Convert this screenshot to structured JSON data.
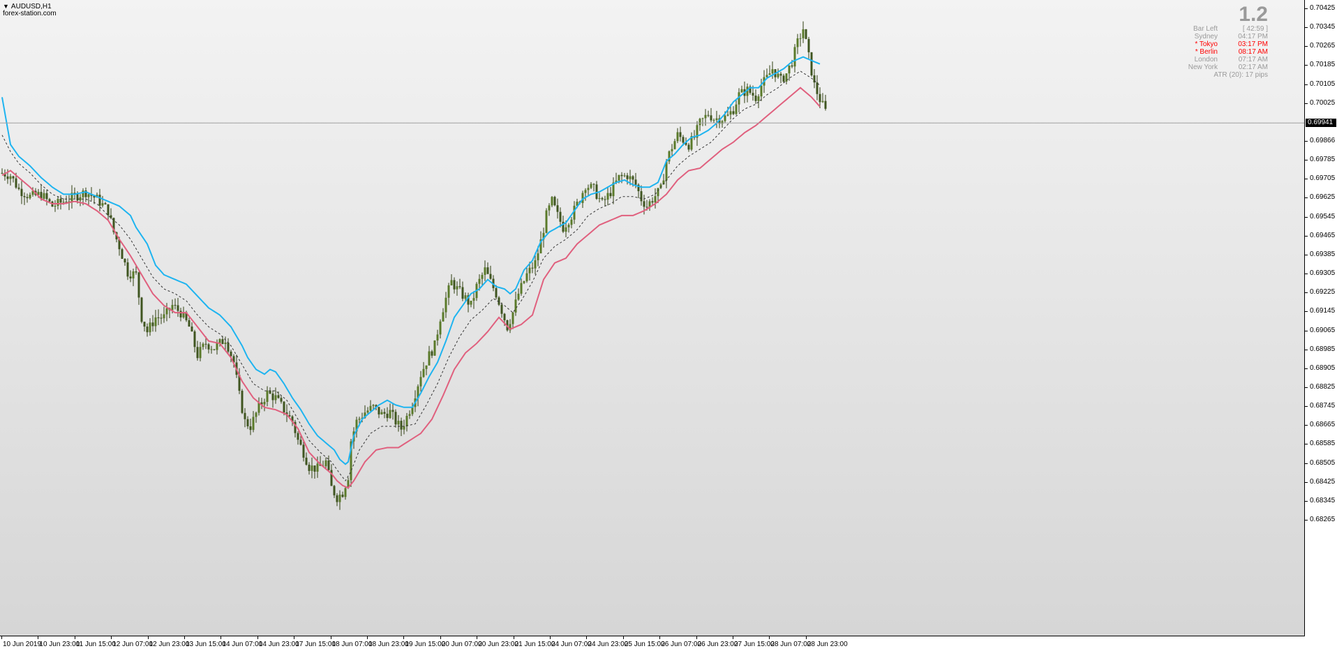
{
  "chart": {
    "symbol_timeframe": "AUDUSD,H1",
    "watermark": "forex-station.com",
    "current_price": "0.69941"
  },
  "session_panel": {
    "big_value": "1.2",
    "rows": [
      {
        "label": "Bar Left",
        "value": "[ 42:59 ]",
        "active": false
      },
      {
        "label": "Sydney",
        "value": "04:17 PM",
        "active": false
      },
      {
        "label": "* Tokyo",
        "value": "03:17 PM",
        "active": true
      },
      {
        "label": "* Berlin",
        "value": "08:17 AM",
        "active": true
      },
      {
        "label": "London",
        "value": "07:17 AM",
        "active": false
      },
      {
        "label": "New York",
        "value": "02:17 AM",
        "active": false
      }
    ],
    "atr": "ATR (20): 17 pips",
    "active_color": "#ff0000",
    "inactive_color": "#9a9a9a"
  },
  "price_axis": {
    "labels": [
      "0.70425",
      "0.70345",
      "0.70265",
      "0.70185",
      "0.70105",
      "0.70025",
      "0.69866",
      "0.69785",
      "0.69705",
      "0.69625",
      "0.69545",
      "0.69465",
      "0.69385",
      "0.69305",
      "0.69225",
      "0.69145",
      "0.69065",
      "0.68985",
      "0.68905",
      "0.68825",
      "0.68745",
      "0.68665",
      "0.68585",
      "0.68505",
      "0.68425",
      "0.68345",
      "0.68265"
    ]
  },
  "time_axis": {
    "labels": [
      "10 Jun 2019",
      "10 Jun 23:00",
      "11 Jun 15:00",
      "12 Jun 07:00",
      "12 Jun 23:00",
      "13 Jun 15:00",
      "14 Jun 07:00",
      "14 Jun 23:00",
      "17 Jun 15:00",
      "18 Jun 07:00",
      "18 Jun 23:00",
      "19 Jun 15:00",
      "20 Jun 07:00",
      "20 Jun 23:00",
      "21 Jun 15:00",
      "24 Jun 07:00",
      "24 Jun 23:00",
      "25 Jun 15:00",
      "26 Jun 07:00",
      "26 Jun 23:00",
      "27 Jun 15:00",
      "28 Jun 07:00",
      "28 Jun 23:00"
    ]
  },
  "colors": {
    "upper_band": "#1eb4f0",
    "lower_band": "#e0607e",
    "mid_line": "#333333",
    "candle_body": "#5a7a2a",
    "candle_wick": "#2e3e10"
  },
  "chart_data": {
    "type": "candlestick",
    "ylim": [
      0.68265,
      0.70465
    ],
    "grid": false,
    "price_anchors": [
      [
        0,
        0.6973
      ],
      [
        3,
        0.6972
      ],
      [
        6,
        0.6966
      ],
      [
        10,
        0.6963
      ],
      [
        14,
        0.6964
      ],
      [
        18,
        0.6959
      ],
      [
        22,
        0.6961
      ],
      [
        26,
        0.6963
      ],
      [
        30,
        0.6965
      ],
      [
        34,
        0.6962
      ],
      [
        38,
        0.6957
      ],
      [
        40,
        0.6948
      ],
      [
        42,
        0.6942
      ],
      [
        45,
        0.6931
      ],
      [
        48,
        0.693
      ],
      [
        50,
        0.6912
      ],
      [
        52,
        0.6906
      ],
      [
        55,
        0.6912
      ],
      [
        58,
        0.6912
      ],
      [
        61,
        0.6917
      ],
      [
        64,
        0.6914
      ],
      [
        67,
        0.6908
      ],
      [
        70,
        0.6896
      ],
      [
        73,
        0.6901
      ],
      [
        76,
        0.6899
      ],
      [
        80,
        0.6903
      ],
      [
        83,
        0.6893
      ],
      [
        85,
        0.6879
      ],
      [
        87,
        0.6868
      ],
      [
        89,
        0.6866
      ],
      [
        92,
        0.6874
      ],
      [
        95,
        0.688
      ],
      [
        98,
        0.6878
      ],
      [
        101,
        0.6873
      ],
      [
        104,
        0.6868
      ],
      [
        106,
        0.686
      ],
      [
        108,
        0.6855
      ],
      [
        110,
        0.6849
      ],
      [
        113,
        0.6848
      ],
      [
        116,
        0.6851
      ],
      [
        118,
        0.684
      ],
      [
        120,
        0.6836
      ],
      [
        122,
        0.6838
      ],
      [
        124,
        0.6845
      ],
      [
        125,
        0.686
      ],
      [
        127,
        0.6868
      ],
      [
        130,
        0.6872
      ],
      [
        133,
        0.6874
      ],
      [
        136,
        0.6871
      ],
      [
        139,
        0.6872
      ],
      [
        141,
        0.6868
      ],
      [
        143,
        0.6865
      ],
      [
        145,
        0.687
      ],
      [
        147,
        0.6876
      ],
      [
        150,
        0.6888
      ],
      [
        153,
        0.6896
      ],
      [
        155,
        0.69
      ],
      [
        157,
        0.6912
      ],
      [
        159,
        0.692
      ],
      [
        161,
        0.6927
      ],
      [
        163,
        0.6924
      ],
      [
        166,
        0.692
      ],
      [
        168,
        0.6917
      ],
      [
        170,
        0.6925
      ],
      [
        173,
        0.6932
      ],
      [
        175,
        0.6927
      ],
      [
        177,
        0.6922
      ],
      [
        179,
        0.6915
      ],
      [
        181,
        0.6908
      ],
      [
        183,
        0.6914
      ],
      [
        185,
        0.6922
      ],
      [
        188,
        0.693
      ],
      [
        191,
        0.6935
      ],
      [
        193,
        0.6944
      ],
      [
        195,
        0.6955
      ],
      [
        197,
        0.6961
      ],
      [
        199,
        0.6955
      ],
      [
        201,
        0.695
      ],
      [
        204,
        0.6955
      ],
      [
        207,
        0.6962
      ],
      [
        209,
        0.6968
      ],
      [
        212,
        0.6966
      ],
      [
        215,
        0.696
      ],
      [
        218,
        0.6965
      ],
      [
        221,
        0.6971
      ],
      [
        224,
        0.6972
      ],
      [
        227,
        0.6968
      ],
      [
        229,
        0.6962
      ],
      [
        231,
        0.6959
      ],
      [
        233,
        0.6962
      ],
      [
        236,
        0.6966
      ],
      [
        238,
        0.6978
      ],
      [
        240,
        0.6984
      ],
      [
        242,
        0.6989
      ],
      [
        244,
        0.6987
      ],
      [
        246,
        0.6985
      ],
      [
        248,
        0.6988
      ],
      [
        250,
        0.6994
      ],
      [
        253,
        0.6998
      ],
      [
        255,
        0.6996
      ],
      [
        258,
        0.6996
      ],
      [
        260,
        0.6997
      ],
      [
        262,
        0.7
      ],
      [
        264,
        0.7006
      ],
      [
        267,
        0.7008
      ],
      [
        270,
        0.7005
      ],
      [
        272,
        0.701
      ],
      [
        274,
        0.7013
      ],
      [
        276,
        0.7017
      ],
      [
        279,
        0.7012
      ],
      [
        281,
        0.7015
      ],
      [
        283,
        0.702
      ],
      [
        285,
        0.7028
      ],
      [
        287,
        0.7034
      ],
      [
        289,
        0.7022
      ],
      [
        291,
        0.701
      ],
      [
        293,
        0.7004
      ],
      [
        295,
        0.6999
      ]
    ],
    "upper_band_anchors": [
      [
        0,
        0.7005
      ],
      [
        3,
        0.6985
      ],
      [
        6,
        0.698
      ],
      [
        10,
        0.6976
      ],
      [
        14,
        0.6971
      ],
      [
        18,
        0.6967
      ],
      [
        22,
        0.6964
      ],
      [
        26,
        0.6964
      ],
      [
        30,
        0.6965
      ],
      [
        34,
        0.6963
      ],
      [
        38,
        0.6961
      ],
      [
        42,
        0.6959
      ],
      [
        46,
        0.6955
      ],
      [
        48,
        0.695
      ],
      [
        52,
        0.6943
      ],
      [
        55,
        0.6934
      ],
      [
        58,
        0.693
      ],
      [
        62,
        0.6928
      ],
      [
        66,
        0.6926
      ],
      [
        70,
        0.6921
      ],
      [
        74,
        0.6916
      ],
      [
        78,
        0.6913
      ],
      [
        82,
        0.6908
      ],
      [
        86,
        0.69
      ],
      [
        88,
        0.6895
      ],
      [
        91,
        0.689
      ],
      [
        94,
        0.6888
      ],
      [
        96,
        0.689
      ],
      [
        98,
        0.6889
      ],
      [
        101,
        0.6884
      ],
      [
        104,
        0.6878
      ],
      [
        107,
        0.6873
      ],
      [
        110,
        0.6867
      ],
      [
        113,
        0.6862
      ],
      [
        116,
        0.6859
      ],
      [
        119,
        0.6856
      ],
      [
        121,
        0.6852
      ],
      [
        123,
        0.685
      ],
      [
        124,
        0.6851
      ],
      [
        126,
        0.6862
      ],
      [
        129,
        0.6869
      ],
      [
        132,
        0.6872
      ],
      [
        135,
        0.6875
      ],
      [
        138,
        0.6877
      ],
      [
        141,
        0.6875
      ],
      [
        144,
        0.6874
      ],
      [
        147,
        0.6874
      ],
      [
        150,
        0.688
      ],
      [
        153,
        0.6887
      ],
      [
        156,
        0.6893
      ],
      [
        159,
        0.6902
      ],
      [
        162,
        0.6912
      ],
      [
        165,
        0.6917
      ],
      [
        168,
        0.6922
      ],
      [
        171,
        0.6924
      ],
      [
        174,
        0.6928
      ],
      [
        177,
        0.6925
      ],
      [
        180,
        0.6924
      ],
      [
        182,
        0.6922
      ],
      [
        184,
        0.6924
      ],
      [
        187,
        0.6932
      ],
      [
        190,
        0.6936
      ],
      [
        193,
        0.6944
      ],
      [
        196,
        0.6948
      ],
      [
        199,
        0.695
      ],
      [
        202,
        0.6952
      ],
      [
        205,
        0.6957
      ],
      [
        208,
        0.6962
      ],
      [
        211,
        0.6964
      ],
      [
        214,
        0.6965
      ],
      [
        217,
        0.6967
      ],
      [
        220,
        0.6969
      ],
      [
        223,
        0.697
      ],
      [
        226,
        0.6968
      ],
      [
        229,
        0.6967
      ],
      [
        232,
        0.6967
      ],
      [
        235,
        0.6969
      ],
      [
        238,
        0.6978
      ],
      [
        241,
        0.6981
      ],
      [
        244,
        0.6985
      ],
      [
        247,
        0.6988
      ],
      [
        250,
        0.6989
      ],
      [
        253,
        0.6991
      ],
      [
        256,
        0.6994
      ],
      [
        259,
        0.6998
      ],
      [
        262,
        0.7003
      ],
      [
        265,
        0.7006
      ],
      [
        268,
        0.7009
      ],
      [
        271,
        0.7009
      ],
      [
        274,
        0.7013
      ],
      [
        277,
        0.7015
      ],
      [
        280,
        0.7017
      ],
      [
        283,
        0.702
      ],
      [
        285,
        0.7021
      ],
      [
        287,
        0.7022
      ],
      [
        289,
        0.7021
      ],
      [
        291,
        0.702
      ],
      [
        293,
        0.7019
      ]
    ],
    "mid_line_anchors": [
      [
        0,
        0.6989
      ],
      [
        3,
        0.6982
      ],
      [
        6,
        0.6977
      ],
      [
        10,
        0.6973
      ],
      [
        14,
        0.6968
      ],
      [
        18,
        0.6964
      ],
      [
        22,
        0.6962
      ],
      [
        26,
        0.6962
      ],
      [
        30,
        0.6962
      ],
      [
        34,
        0.696
      ],
      [
        38,
        0.6955
      ],
      [
        42,
        0.6951
      ],
      [
        46,
        0.6945
      ],
      [
        50,
        0.6937
      ],
      [
        54,
        0.6929
      ],
      [
        58,
        0.6924
      ],
      [
        62,
        0.6922
      ],
      [
        66,
        0.6919
      ],
      [
        70,
        0.6913
      ],
      [
        74,
        0.6908
      ],
      [
        78,
        0.6905
      ],
      [
        82,
        0.69
      ],
      [
        86,
        0.6892
      ],
      [
        90,
        0.6884
      ],
      [
        94,
        0.6881
      ],
      [
        98,
        0.6881
      ],
      [
        102,
        0.6877
      ],
      [
        106,
        0.6869
      ],
      [
        110,
        0.686
      ],
      [
        114,
        0.6855
      ],
      [
        118,
        0.6851
      ],
      [
        121,
        0.6846
      ],
      [
        123,
        0.6843
      ],
      [
        125,
        0.6847
      ],
      [
        128,
        0.6856
      ],
      [
        132,
        0.6863
      ],
      [
        136,
        0.6866
      ],
      [
        140,
        0.6866
      ],
      [
        144,
        0.6866
      ],
      [
        148,
        0.6867
      ],
      [
        152,
        0.6875
      ],
      [
        156,
        0.6884
      ],
      [
        160,
        0.6895
      ],
      [
        164,
        0.6904
      ],
      [
        168,
        0.6911
      ],
      [
        172,
        0.6915
      ],
      [
        176,
        0.692
      ],
      [
        180,
        0.6917
      ],
      [
        183,
        0.6914
      ],
      [
        186,
        0.6919
      ],
      [
        190,
        0.6927
      ],
      [
        194,
        0.6937
      ],
      [
        198,
        0.6942
      ],
      [
        202,
        0.6945
      ],
      [
        206,
        0.6949
      ],
      [
        210,
        0.6955
      ],
      [
        214,
        0.6958
      ],
      [
        218,
        0.696
      ],
      [
        222,
        0.6963
      ],
      [
        226,
        0.6963
      ],
      [
        230,
        0.6962
      ],
      [
        234,
        0.6964
      ],
      [
        238,
        0.697
      ],
      [
        242,
        0.6976
      ],
      [
        246,
        0.698
      ],
      [
        250,
        0.6983
      ],
      [
        254,
        0.6986
      ],
      [
        258,
        0.6991
      ],
      [
        262,
        0.6996
      ],
      [
        266,
        0.7
      ],
      [
        270,
        0.7002
      ],
      [
        274,
        0.7006
      ],
      [
        278,
        0.7009
      ],
      [
        282,
        0.7013
      ],
      [
        286,
        0.7016
      ],
      [
        290,
        0.7013
      ],
      [
        293,
        0.701
      ]
    ],
    "lower_band_anchors": [
      [
        0,
        0.6972
      ],
      [
        3,
        0.6974
      ],
      [
        6,
        0.6971
      ],
      [
        10,
        0.6967
      ],
      [
        14,
        0.6962
      ],
      [
        18,
        0.696
      ],
      [
        22,
        0.696
      ],
      [
        26,
        0.6961
      ],
      [
        30,
        0.696
      ],
      [
        34,
        0.6957
      ],
      [
        38,
        0.6953
      ],
      [
        42,
        0.6945
      ],
      [
        46,
        0.6938
      ],
      [
        50,
        0.693
      ],
      [
        54,
        0.6922
      ],
      [
        58,
        0.6917
      ],
      [
        62,
        0.6914
      ],
      [
        66,
        0.6914
      ],
      [
        70,
        0.6908
      ],
      [
        74,
        0.6902
      ],
      [
        78,
        0.6901
      ],
      [
        82,
        0.6895
      ],
      [
        86,
        0.6885
      ],
      [
        90,
        0.6878
      ],
      [
        94,
        0.6874
      ],
      [
        98,
        0.6873
      ],
      [
        102,
        0.6871
      ],
      [
        106,
        0.6865
      ],
      [
        110,
        0.6855
      ],
      [
        114,
        0.685
      ],
      [
        118,
        0.6846
      ],
      [
        120,
        0.6843
      ],
      [
        122,
        0.6841
      ],
      [
        124,
        0.684
      ],
      [
        126,
        0.6843
      ],
      [
        130,
        0.6851
      ],
      [
        134,
        0.6856
      ],
      [
        138,
        0.6857
      ],
      [
        142,
        0.6857
      ],
      [
        146,
        0.686
      ],
      [
        150,
        0.6863
      ],
      [
        154,
        0.6869
      ],
      [
        158,
        0.6879
      ],
      [
        162,
        0.689
      ],
      [
        166,
        0.6897
      ],
      [
        170,
        0.6901
      ],
      [
        174,
        0.6906
      ],
      [
        178,
        0.6912
      ],
      [
        182,
        0.6907
      ],
      [
        186,
        0.6909
      ],
      [
        190,
        0.6913
      ],
      [
        194,
        0.6928
      ],
      [
        198,
        0.6935
      ],
      [
        202,
        0.6937
      ],
      [
        206,
        0.6943
      ],
      [
        210,
        0.6947
      ],
      [
        214,
        0.6951
      ],
      [
        218,
        0.6953
      ],
      [
        222,
        0.6955
      ],
      [
        226,
        0.6955
      ],
      [
        230,
        0.6957
      ],
      [
        234,
        0.696
      ],
      [
        238,
        0.6964
      ],
      [
        242,
        0.697
      ],
      [
        246,
        0.6974
      ],
      [
        250,
        0.6975
      ],
      [
        254,
        0.6979
      ],
      [
        258,
        0.6983
      ],
      [
        262,
        0.6986
      ],
      [
        266,
        0.699
      ],
      [
        270,
        0.6993
      ],
      [
        274,
        0.6997
      ],
      [
        278,
        0.7001
      ],
      [
        282,
        0.7005
      ],
      [
        286,
        0.7009
      ],
      [
        290,
        0.7005
      ],
      [
        293,
        0.7001
      ]
    ]
  }
}
